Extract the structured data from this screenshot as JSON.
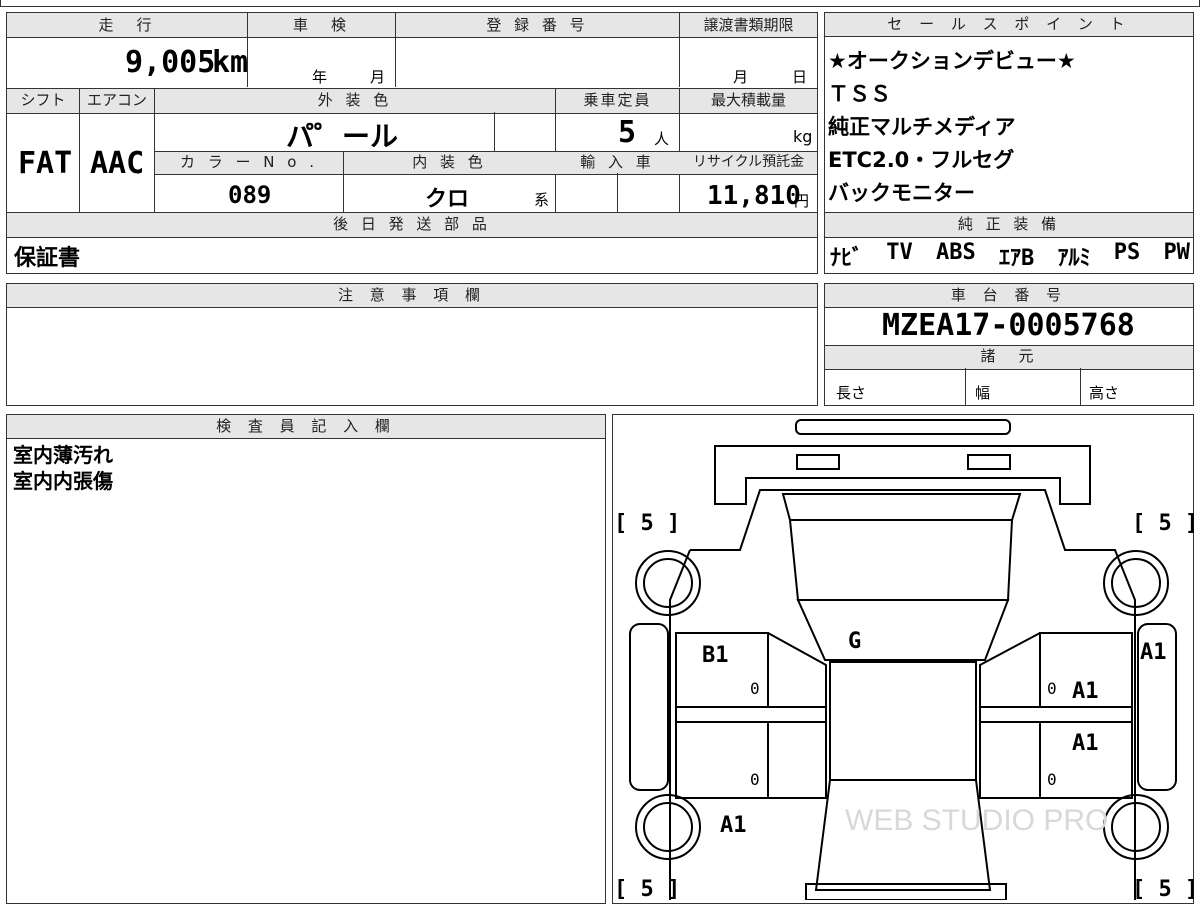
{
  "vehicle_info": {
    "mileage_label": "走　行",
    "mileage_value": "9,005",
    "mileage_unit": "km",
    "inspection_label": "車　検",
    "inspection_year": "年",
    "inspection_month": "月",
    "registration_label": "登 録 番 号",
    "transfer_doc_label": "譲渡書類期限",
    "transfer_month": "月",
    "transfer_day": "日",
    "shift_label": "シフト",
    "shift_value": "FAT",
    "aircon_label": "エアコン",
    "aircon_value": "AAC",
    "exterior_color_label": "外 装 色",
    "exterior_color_value": "パ゜ール",
    "capacity_label": "乗車定員",
    "capacity_value": "5",
    "capacity_unit": "人",
    "max_load_label": "最大積載量",
    "max_load_unit": "kg",
    "color_no_label": "カ ラ ー N o .",
    "color_no_value": "089",
    "interior_color_label": "内 装 色",
    "interior_color_value": "クロ",
    "interior_color_suffix": "系",
    "import_label": "輸 入 車",
    "recycle_label": "リサイクル預託金",
    "recycle_value": "11,810",
    "recycle_unit": "円",
    "later_parts_label": "後 日 発 送 部 品",
    "later_parts_value": "保証書"
  },
  "sales_points": {
    "label": "セ ー ル ス ポ イ ン ト",
    "items": [
      "★オークションデビュー★",
      "ＴＳＳ",
      "純正マルチメディア",
      "ETC2.0・フルセグ",
      "バックモニター"
    ]
  },
  "equipment": {
    "label": "純 正 装 備",
    "items": [
      "ﾅﾋﾞ",
      "TV",
      "ABS",
      "ｴｱB",
      "ｱﾙﾐ",
      "PS",
      "PW"
    ]
  },
  "notes": {
    "label": "注 意 事 項 欄"
  },
  "chassis": {
    "label": "車 台 番 号",
    "value": "MZEA17-0005768"
  },
  "specs": {
    "label": "諸　元",
    "length": "長さ",
    "width": "幅",
    "height": "高さ"
  },
  "inspector": {
    "label": "検 査 員 記 入 欄",
    "lines": [
      "室内薄汚れ",
      "室内内張傷"
    ]
  },
  "diagram": {
    "tire_fl": "[ 5 ]",
    "tire_fr": "[ 5 ]",
    "tire_rl": "[ 5 ]",
    "tire_rr": "[ 5 ]",
    "mark_windshield": "G",
    "mark_left_front_door": "B1",
    "mark_right_fender": "A1",
    "mark_right_front_door": "A1",
    "mark_right_rear_door": "A1",
    "mark_left_rear_quarter": "A1",
    "door_zero": "0",
    "watermark": "WEB STUDIO PRO"
  }
}
